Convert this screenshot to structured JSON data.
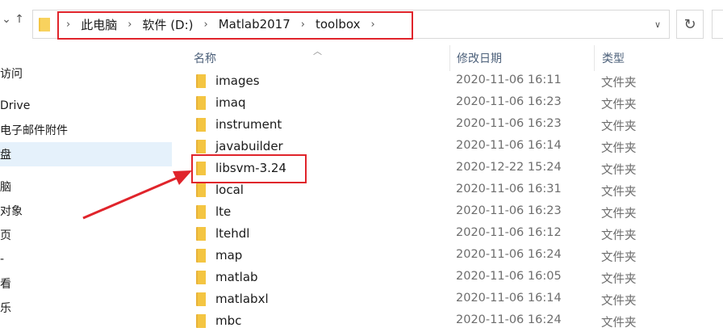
{
  "address_bar": {
    "crumbs": [
      "此电脑",
      "软件 (D:)",
      "Matlab2017",
      "toolbox"
    ],
    "nav_up_glyph": "↑",
    "nav_down_glyph": "⌄",
    "refresh_glyph": "↻"
  },
  "sidebar": {
    "items": [
      {
        "label": "访问"
      },
      {
        "label": "Drive"
      },
      {
        "label": "电子邮件附件"
      },
      {
        "label": "盘",
        "selected": true
      },
      {
        "label": "脑"
      },
      {
        "label": "对象"
      },
      {
        "label": "页"
      },
      {
        "label": "-"
      },
      {
        "label": "看"
      },
      {
        "label": "乐"
      }
    ]
  },
  "list": {
    "headers": {
      "name": "名称",
      "date": "修改日期",
      "type": "类型"
    },
    "rows": [
      {
        "name": "images",
        "date": "2020-11-06 16:11",
        "type": "文件夹"
      },
      {
        "name": "imaq",
        "date": "2020-11-06 16:23",
        "type": "文件夹"
      },
      {
        "name": "instrument",
        "date": "2020-11-06 16:23",
        "type": "文件夹"
      },
      {
        "name": "javabuilder",
        "date": "2020-11-06 16:14",
        "type": "文件夹"
      },
      {
        "name": "libsvm-3.24",
        "date": "2020-12-22 15:24",
        "type": "文件夹"
      },
      {
        "name": "local",
        "date": "2020-11-06 16:31",
        "type": "文件夹"
      },
      {
        "name": "lte",
        "date": "2020-11-06 16:23",
        "type": "文件夹"
      },
      {
        "name": "ltehdl",
        "date": "2020-11-06 16:12",
        "type": "文件夹"
      },
      {
        "name": "map",
        "date": "2020-11-06 16:24",
        "type": "文件夹"
      },
      {
        "name": "matlab",
        "date": "2020-11-06 16:05",
        "type": "文件夹"
      },
      {
        "name": "matlabxl",
        "date": "2020-11-06 16:14",
        "type": "文件夹"
      },
      {
        "name": "mbc",
        "date": "2020-11-06 16:24",
        "type": "文件夹"
      }
    ]
  },
  "colors": {
    "highlight": "#e0242b",
    "folder": "#f4c542",
    "selected_bg": "#e5f1fb"
  }
}
